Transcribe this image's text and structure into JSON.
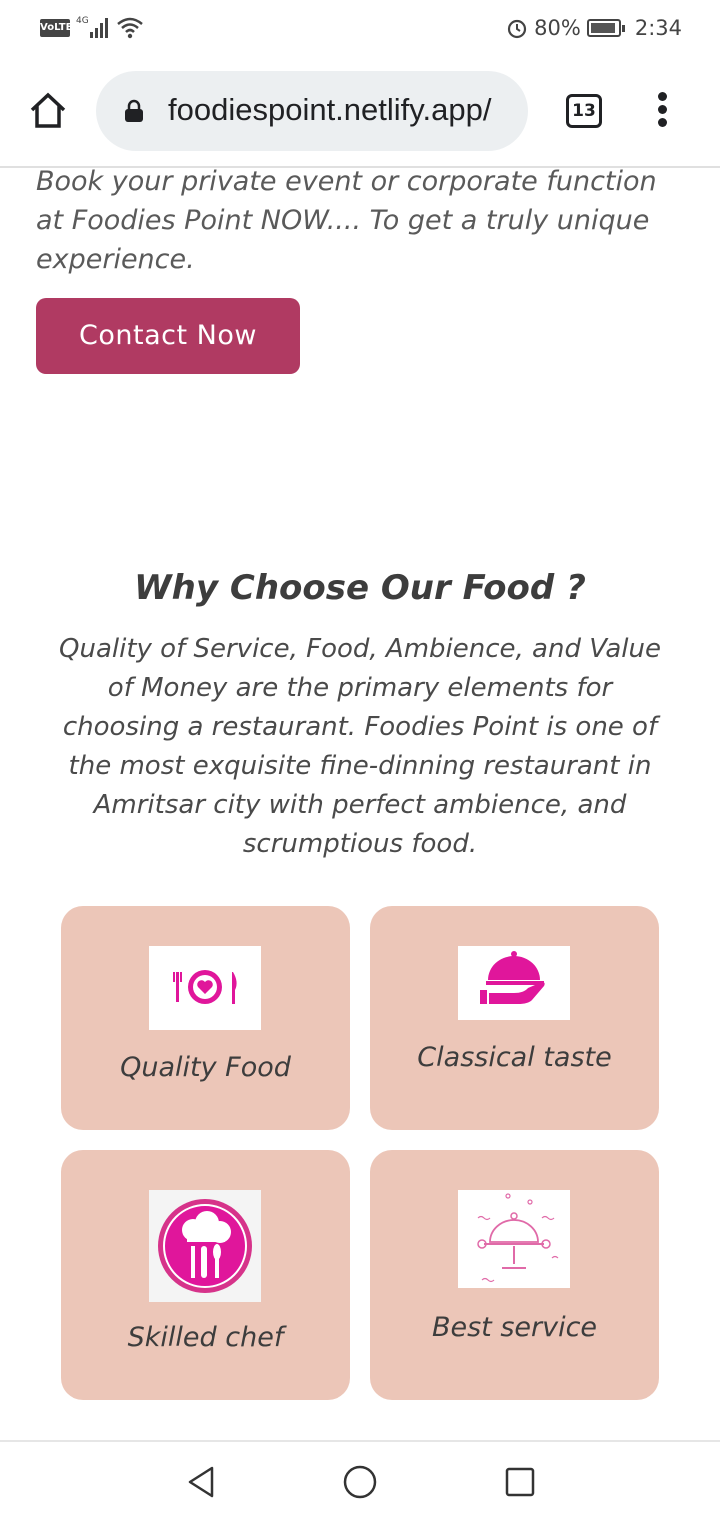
{
  "status": {
    "network": "4G",
    "volte": "VoLTE",
    "battery": "80%",
    "time": "2:34"
  },
  "browser": {
    "url": "foodiespoint.netlify.app/",
    "tab_count": "13"
  },
  "intro": {
    "text": "Book your private event or corporate function at Foodies Point NOW.... To get a truly unique experience.",
    "cta_label": "Contact Now"
  },
  "why": {
    "title": "Why Choose Our Food ?",
    "text": "Quality of Service, Food, Ambience, and Value of Money are the primary elements for choosing a restaurant. Foodies Point is one of the most exquisite fine-dinning restaurant in Amritsar city with perfect ambience, and scrumptious food."
  },
  "features": [
    {
      "label": "Quality Food",
      "icon": "plate-heart-icon"
    },
    {
      "label": "Classical taste",
      "icon": "serving-cloche-hand-icon"
    },
    {
      "label": "Skilled chef",
      "icon": "chef-hat-cutlery-icon"
    },
    {
      "label": "Best service",
      "icon": "serving-tray-icon"
    }
  ],
  "colors": {
    "accent": "#b03a62",
    "card": "#ecc6b8",
    "icon_pink": "#e0169b"
  }
}
